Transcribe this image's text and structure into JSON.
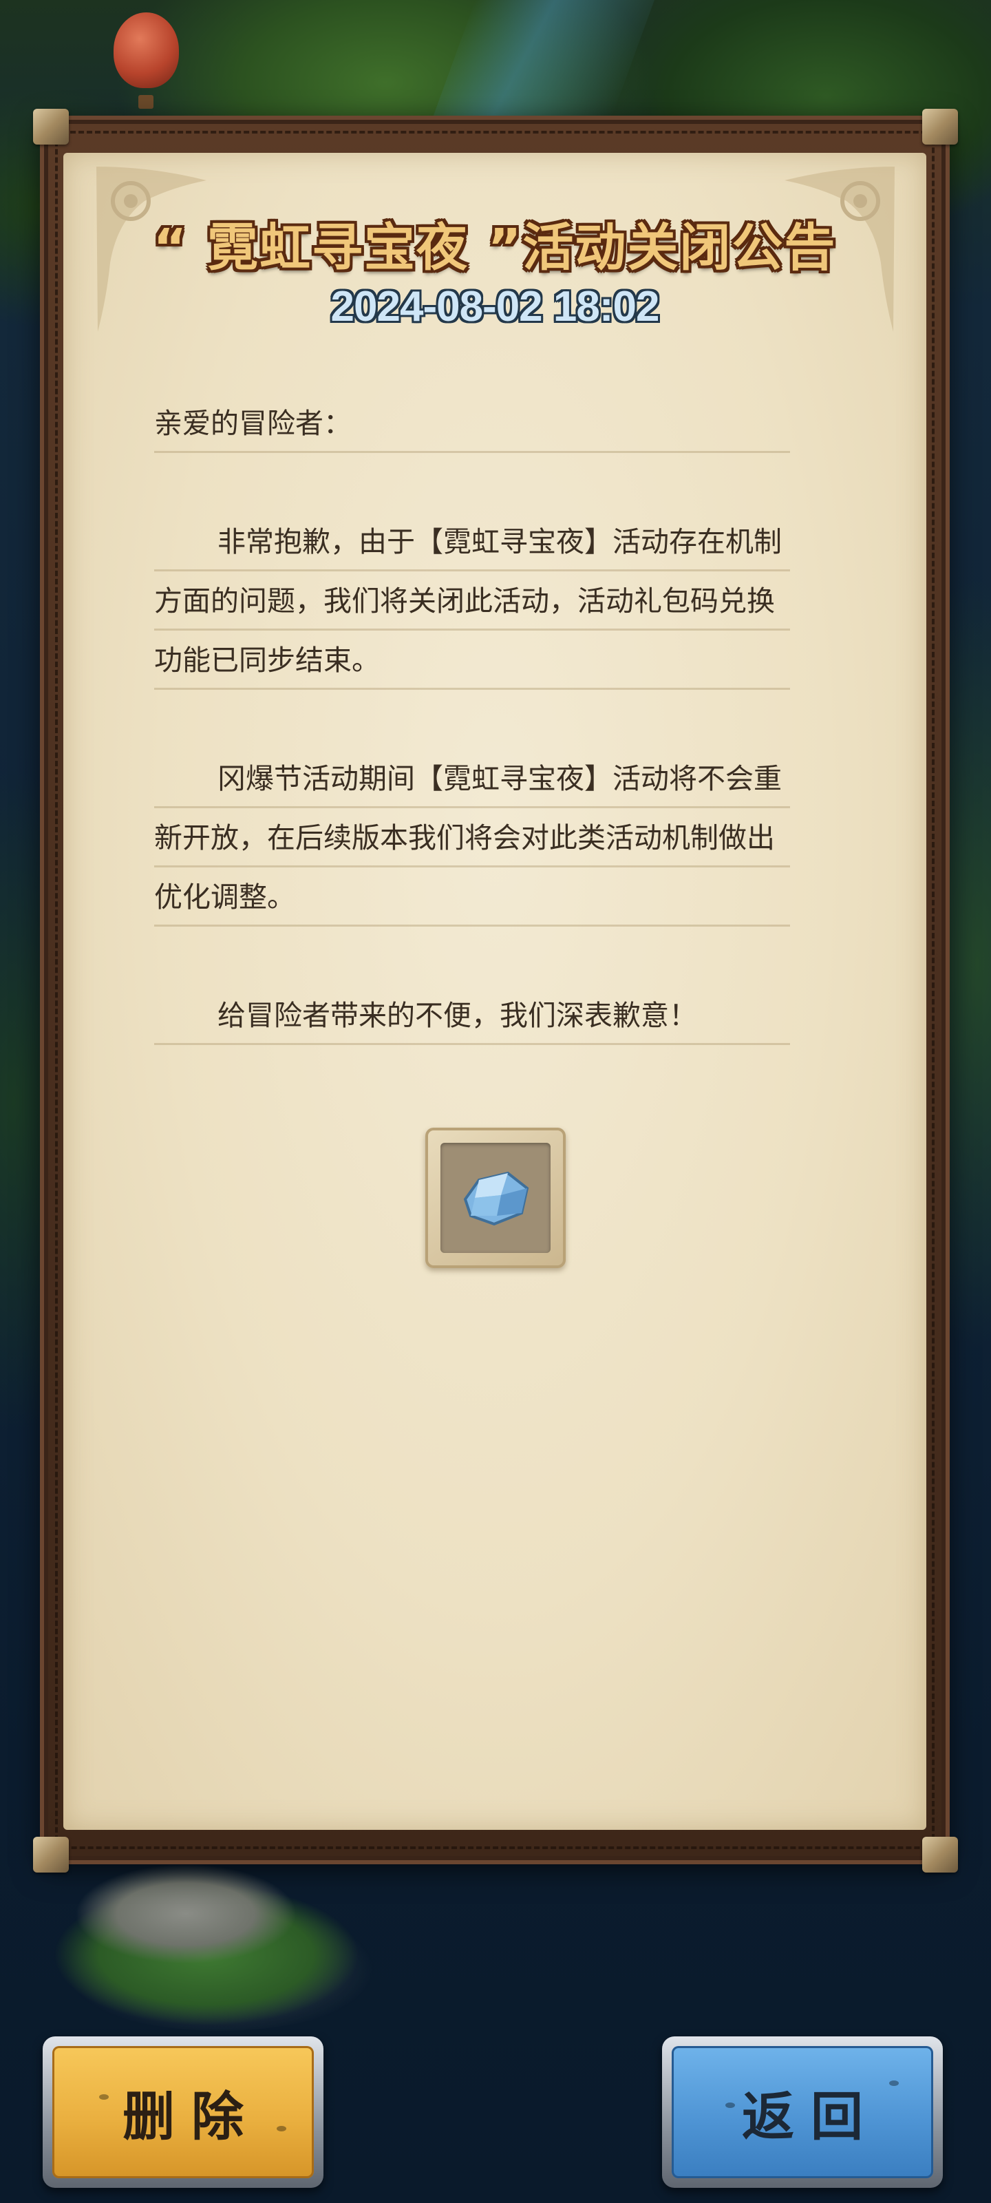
{
  "notice": {
    "title": "“ 霓虹寻宝夜 ”活动关闭公告",
    "date": "2024-08-02 18:02",
    "greeting": "亲爱的冒险者：",
    "paragraphs": [
      "非常抱歉，由于【霓虹寻宝夜】活动存在机制方面的问题，我们将关闭此活动，活动礼包码兑换功能已同步结束。",
      "冈爆节活动期间【霓虹寻宝夜】活动将不会重新开放，在后续版本我们将会对此类活动机制做出优化调整。",
      "给冒险者带来的不便，我们深表歉意！"
    ],
    "attachment_icon": "crystal-icon"
  },
  "buttons": {
    "delete_label": "删除",
    "back_label": "返回"
  },
  "colors": {
    "title_fill": "#f0c77a",
    "title_outline": "#5a2a10",
    "date_fill": "#cfe6f7",
    "delete_button": "#eab040",
    "back_button": "#4f95d5",
    "parchment": "#ede1c3"
  }
}
